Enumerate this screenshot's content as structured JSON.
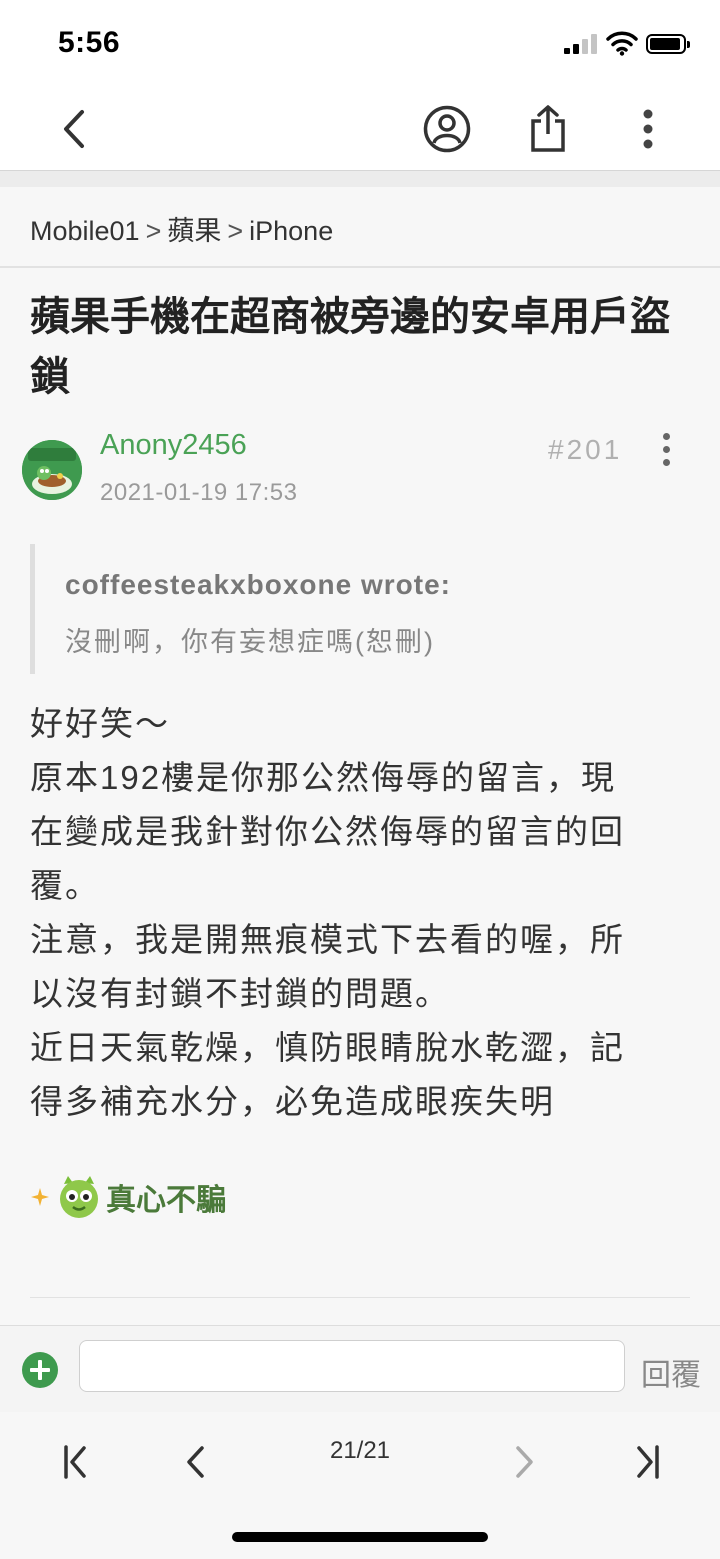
{
  "status_bar": {
    "time": "5:56",
    "icons": [
      "signal-icon",
      "wifi-icon",
      "battery-icon"
    ]
  },
  "nav": {
    "icons": [
      "back-arrow-icon",
      "user-circle-icon",
      "share-icon",
      "more-vertical-icon"
    ]
  },
  "breadcrumb": {
    "items": [
      "Mobile01",
      "蘋果",
      "iPhone"
    ],
    "separator": ">"
  },
  "thread": {
    "title": "蘋果手機在超商被旁邊的安卓用戶盜鎖"
  },
  "post": {
    "author": "Anony2456",
    "date": "2021-01-19 17:53",
    "floor": "#201",
    "quote": {
      "author_line": "coffeesteakxboxone wrote:",
      "text": "沒刪啊，你有妄想症嗎(恕刪)"
    },
    "body_lines": [
      "好好笑～",
      "原本192樓是你那公然侮辱的留言，現",
      "在變成是我針對你公然侮辱的留言的回",
      "覆。",
      "注意，我是開無痕模式下去看的喔，所",
      "以沒有封鎖不封鎖的問題。",
      "",
      "近日天氣乾燥，慎防眼睛脫水乾澀，記",
      "得多補充水分，必免造成眼疾失明"
    ],
    "signature_text": "真心不騙"
  },
  "reply_bar": {
    "input_value": "",
    "send_label": "回覆"
  },
  "pager": {
    "label": "21/21"
  },
  "colors": {
    "accent_green": "#4aa256",
    "content_bg": "#f7f7f7"
  }
}
